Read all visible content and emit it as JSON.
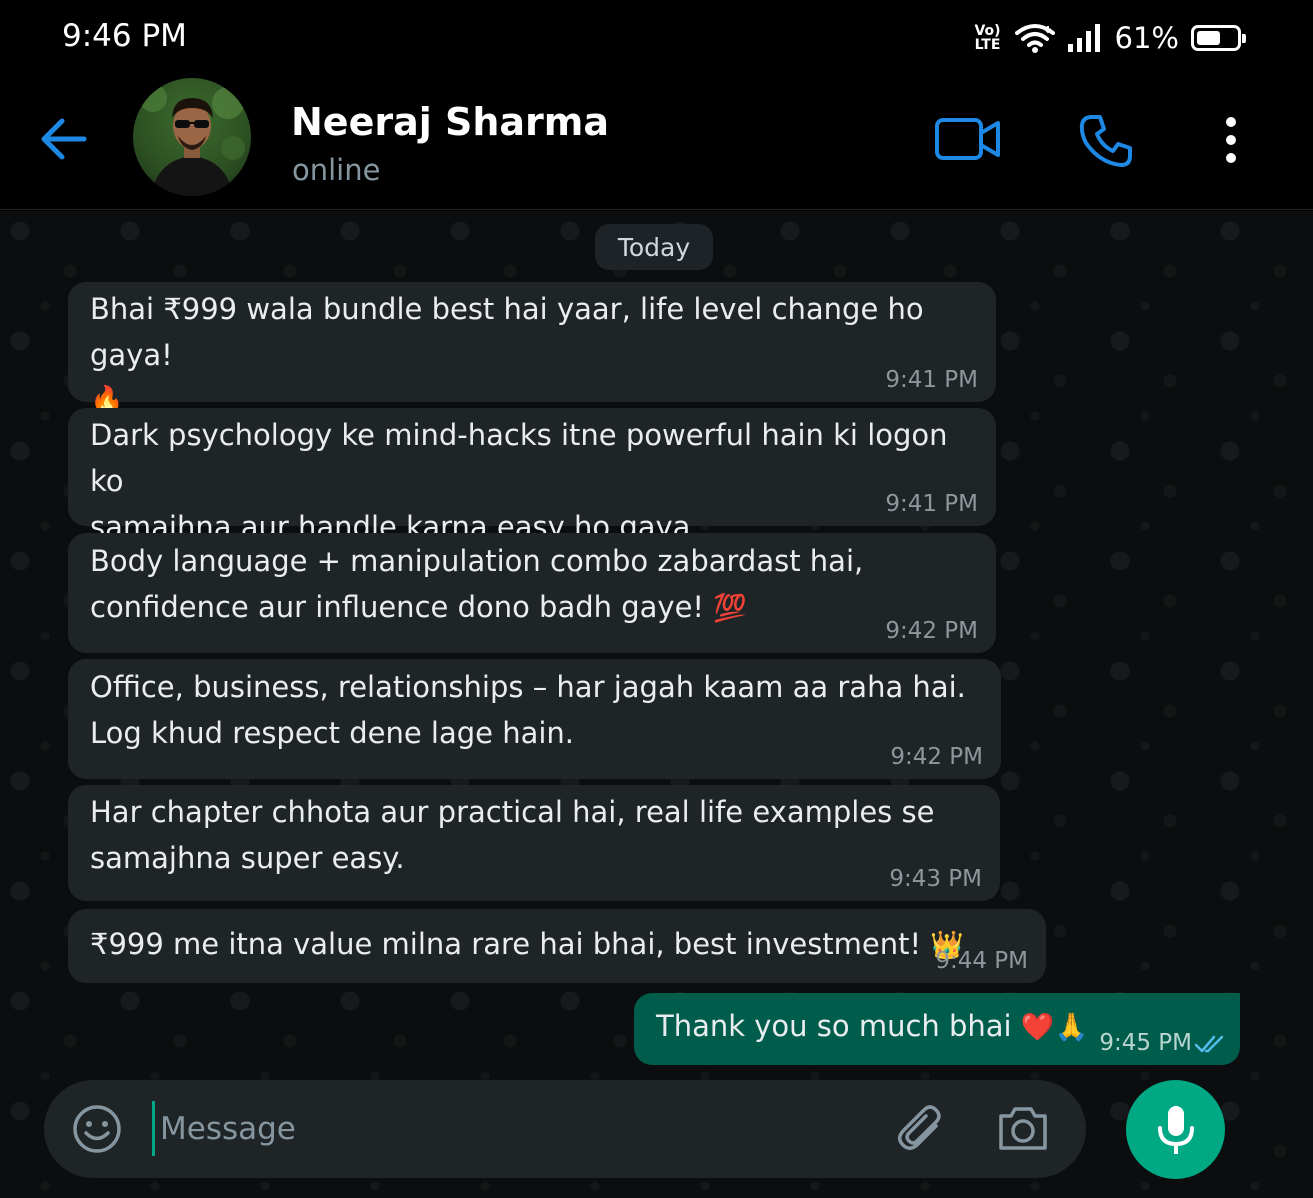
{
  "status_bar": {
    "time": "9:46 PM",
    "volte_top": "Vo)",
    "volte_bottom": "LTE",
    "battery_percent_label": "61%",
    "battery_level": 0.61
  },
  "header": {
    "contact_name": "Neeraj Sharma",
    "contact_status": "online",
    "accent_color": "#1e88e5"
  },
  "chat": {
    "date_label": "Today",
    "messages": [
      {
        "direction": "incoming",
        "line1": "Bhai ₹999 wala bundle best hai yaar, life level change ho gaya!",
        "emoji": "🔥",
        "time": "9:41 PM"
      },
      {
        "direction": "incoming",
        "line1": "Dark psychology ke mind-hacks itne powerful hain ki logon ko",
        "line2": "samajhna aur handle karna easy ho gaya.",
        "time": "9:41 PM"
      },
      {
        "direction": "incoming",
        "line1": "Body language + manipulation combo zabardast hai,",
        "line2": "confidence aur influence dono badh gaye!",
        "emoji": "💯",
        "time": "9:42 PM"
      },
      {
        "direction": "incoming",
        "line1": "Office, business, relationships – har jagah kaam aa raha hai.",
        "line2": "Log khud respect dene lage hain.",
        "time": "9:42 PM"
      },
      {
        "direction": "incoming",
        "line1": "Har chapter chhota aur practical hai, real life examples se",
        "line2": "samajhna super easy.",
        "time": "9:43 PM"
      },
      {
        "direction": "incoming",
        "line1": "₹999 me itna value milna rare hai bhai, best investment!",
        "emoji": "👑",
        "time": "9:44 PM"
      },
      {
        "direction": "outgoing",
        "line1": "Thank you so much bhai",
        "emoji": "❤️🙏",
        "time": "9:45 PM",
        "status": "read"
      }
    ]
  },
  "composer": {
    "placeholder": "Message"
  },
  "icons": {
    "back": "arrow-left-icon",
    "video": "video-camera-icon",
    "call": "phone-icon",
    "menu": "more-vertical-icon",
    "emoji": "smiley-icon",
    "attach": "paperclip-icon",
    "camera": "camera-icon",
    "mic": "microphone-icon",
    "read": "double-check-icon"
  },
  "colors": {
    "incoming_bubble": "#1f2426",
    "outgoing_bubble": "#005c4b",
    "mic_button": "#00a884",
    "read_ticks": "#53bdeb"
  }
}
